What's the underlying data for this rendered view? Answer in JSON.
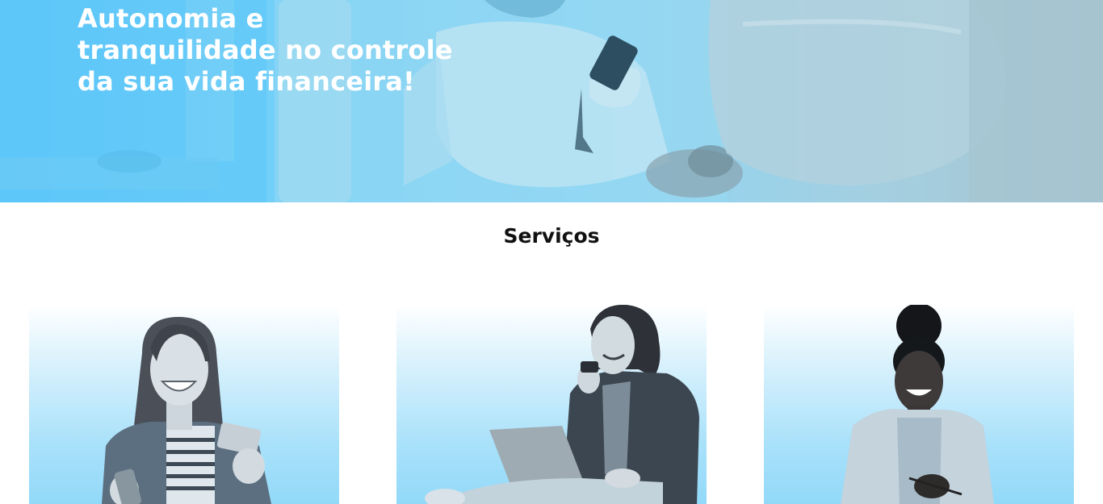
{
  "hero": {
    "title": "Autonomia e tranquilidade no controle da sua vida financeira!"
  },
  "services": {
    "title": "Serviços",
    "cards": [
      {
        "photo": "woman-with-phone-and-card"
      },
      {
        "photo": "man-with-laptop-thinking"
      },
      {
        "photo": "woman-in-blazer-smiling"
      }
    ]
  },
  "colors": {
    "accent": "#5ec8fb",
    "card_gradient_bottom": "#92d9f9",
    "title_text": "#111111"
  }
}
